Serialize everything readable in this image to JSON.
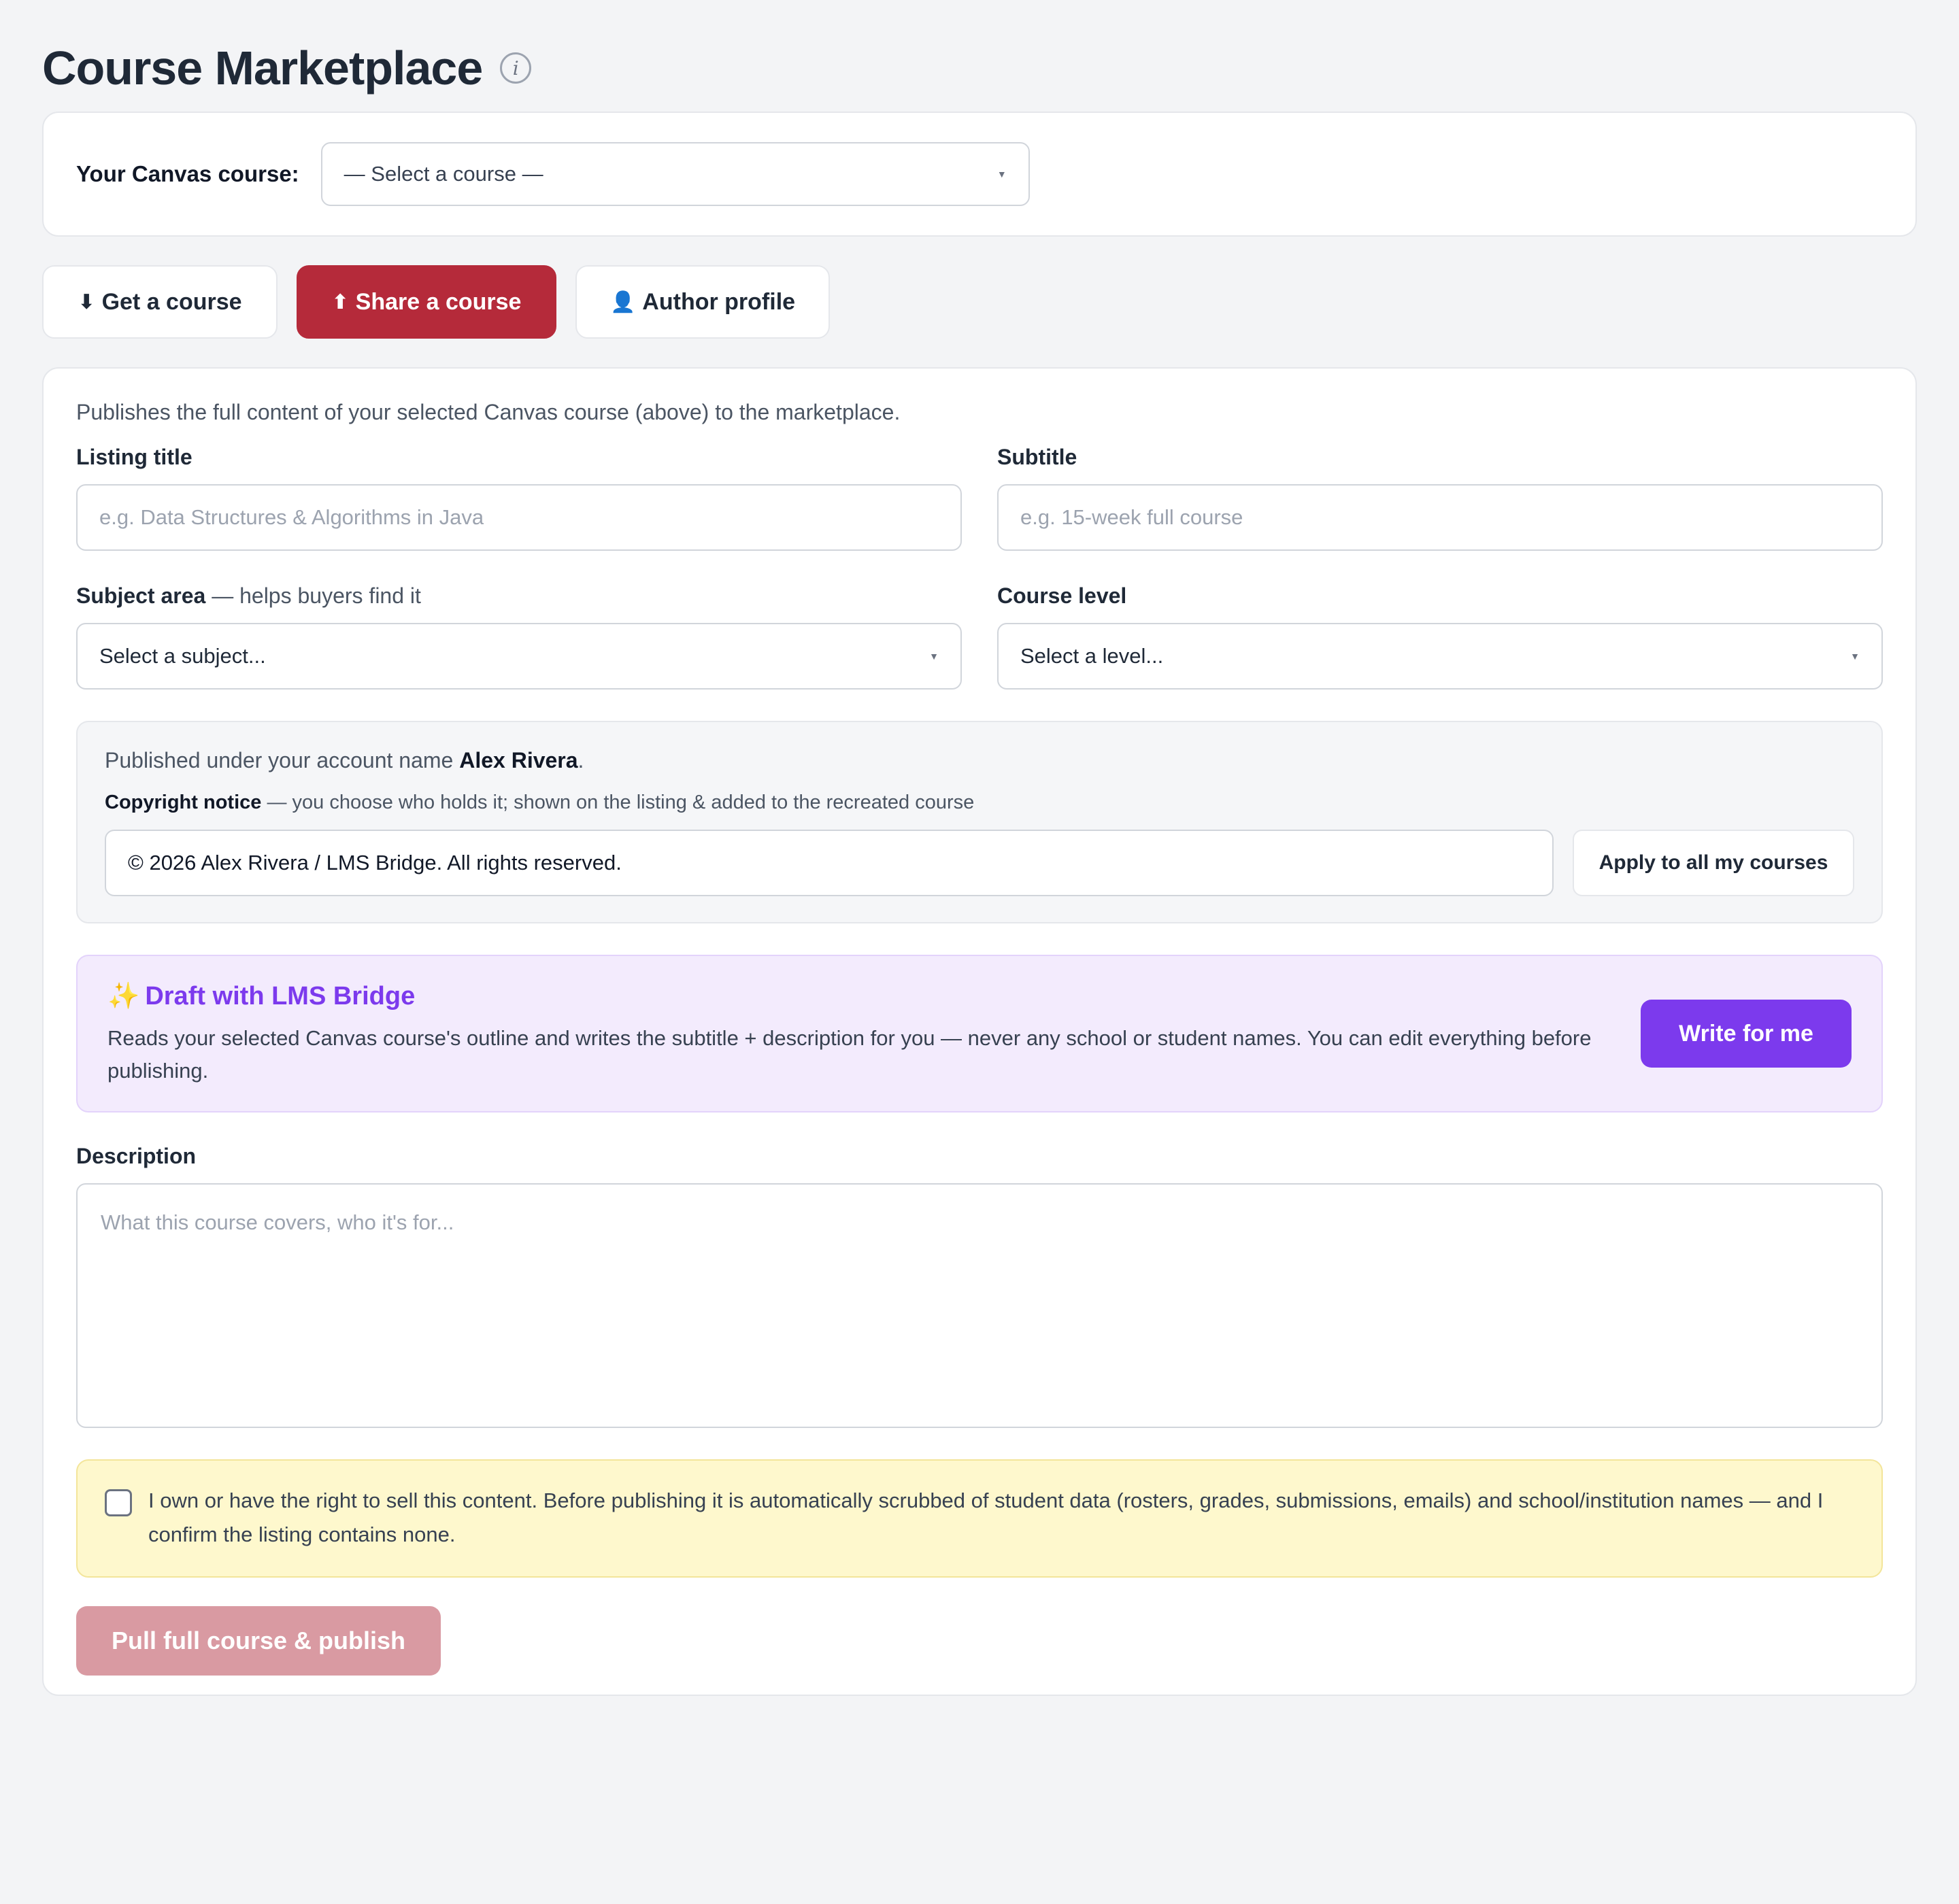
{
  "header": {
    "title": "Course Marketplace",
    "info_icon": "i"
  },
  "course_picker": {
    "label": "Your Canvas course:",
    "selected": "— Select a course —"
  },
  "tabs": [
    {
      "icon": "⬇",
      "label": "Get a course",
      "active": false
    },
    {
      "icon": "⬆",
      "label": "Share a course",
      "active": true
    },
    {
      "icon": "👤",
      "label": "Author profile",
      "active": false
    }
  ],
  "share": {
    "intro": "Publishes the full content of your selected Canvas course (above) to the marketplace.",
    "listing_title": {
      "label": "Listing title",
      "placeholder": "e.g. Data Structures & Algorithms in Java"
    },
    "subtitle": {
      "label": "Subtitle",
      "placeholder": "e.g. 15-week full course"
    },
    "subject": {
      "label": "Subject area",
      "hint": " — helps buyers find it",
      "selected": "Select a subject..."
    },
    "level": {
      "label": "Course level",
      "selected": "Select a level..."
    },
    "account": {
      "prefix": "Published under your account name ",
      "name": "Alex Rivera",
      "suffix": ".",
      "copyright_label": "Copyright notice",
      "copyright_hint": " — you choose who holds it; shown on the listing & added to the recreated course",
      "copyright_value": "© 2026 Alex Rivera / LMS Bridge. All rights reserved.",
      "apply_label": "Apply to all my courses"
    },
    "ai": {
      "sparkle": "✨",
      "title": "Draft with LMS Bridge",
      "description": "Reads your selected Canvas course's outline and writes the subtitle + description for you — never any school or student names. You can edit everything before publishing.",
      "button": "Write for me"
    },
    "description": {
      "label": "Description",
      "placeholder": "What this course covers, who it's for..."
    },
    "consent": "I own or have the right to sell this content. Before publishing it is automatically scrubbed of student data (rosters, grades, submissions, emails) and school/institution names — and I confirm the listing contains none.",
    "publish_button": "Pull full course & publish"
  },
  "colors": {
    "accent_red": "#b52a3a",
    "accent_purple": "#7c3aed",
    "publish_disabled": "#d99aa2"
  },
  "icons": {
    "info": "info-icon",
    "caret": "chevron-down-icon",
    "download": "arrow-down-icon",
    "upload": "arrow-up-icon",
    "user": "user-icon",
    "sparkle": "sparkle-icon"
  }
}
